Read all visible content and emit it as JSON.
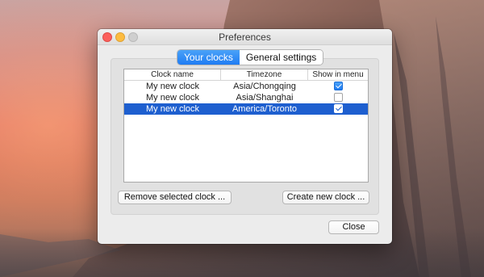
{
  "window": {
    "title": "Preferences"
  },
  "tabs": [
    {
      "label": "Your clocks",
      "active": true
    },
    {
      "label": "General settings",
      "active": false
    }
  ],
  "table": {
    "columns": [
      "Clock name",
      "Timezone",
      "Show in menu"
    ],
    "rows": [
      {
        "name": "My new clock",
        "timezone": "Asia/Chongqing",
        "show": true,
        "selected": false
      },
      {
        "name": "My new clock",
        "timezone": "Asia/Shanghai",
        "show": false,
        "selected": false
      },
      {
        "name": "My new clock",
        "timezone": "America/Toronto",
        "show": true,
        "selected": true
      }
    ]
  },
  "buttons": {
    "remove": "Remove selected clock ...",
    "create": "Create new clock ...",
    "close": "Close"
  },
  "colors": {
    "accent": "#1f7cf3",
    "selection": "#1e5fcf"
  }
}
